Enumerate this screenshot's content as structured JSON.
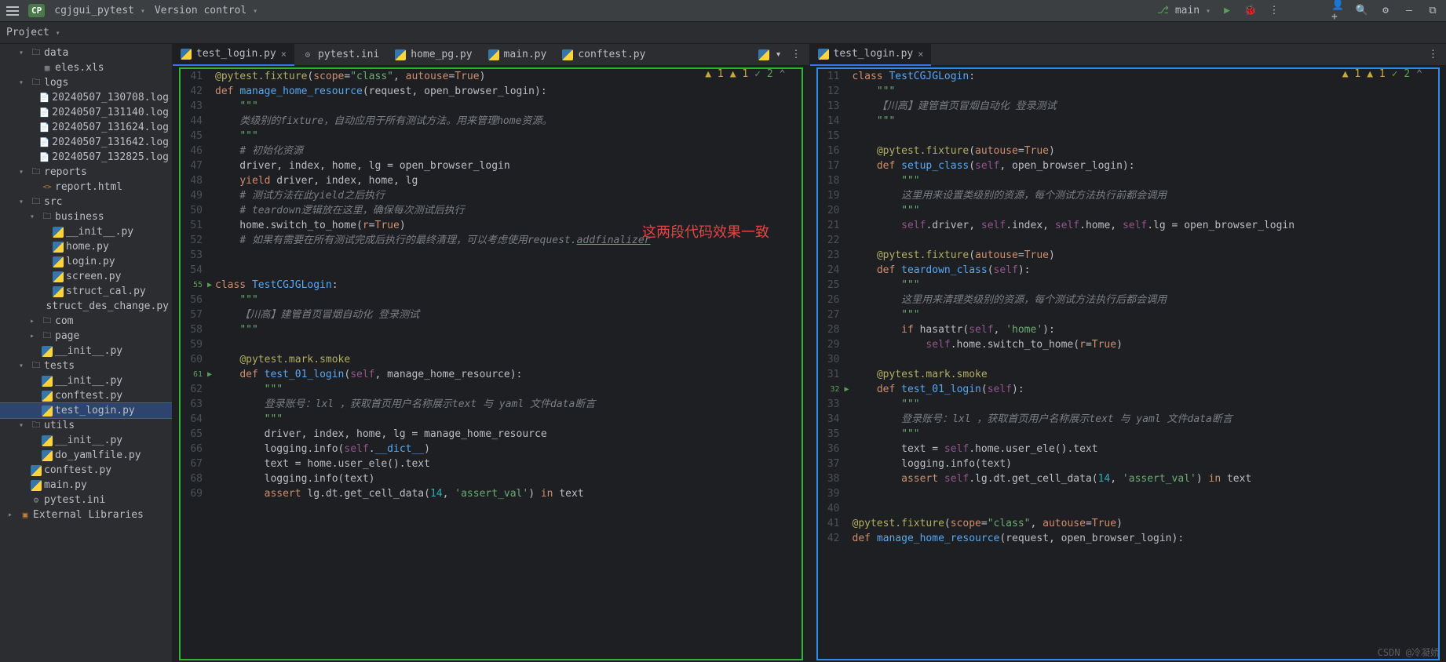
{
  "topbar": {
    "project_badge": "CP",
    "project_name": "cgjgui_pytest",
    "menu_vcs": "Version control",
    "branch": "main"
  },
  "project_header": {
    "title": "Project"
  },
  "tree": [
    {
      "indent": 1,
      "chev": "exp",
      "ico": "dir",
      "label": "data"
    },
    {
      "indent": 2,
      "chev": "none",
      "ico": "xls",
      "label": "eles.xls"
    },
    {
      "indent": 1,
      "chev": "exp",
      "ico": "dir",
      "label": "logs"
    },
    {
      "indent": 2,
      "chev": "none",
      "ico": "log",
      "label": "20240507_130708.log"
    },
    {
      "indent": 2,
      "chev": "none",
      "ico": "log",
      "label": "20240507_131140.log"
    },
    {
      "indent": 2,
      "chev": "none",
      "ico": "log",
      "label": "20240507_131624.log"
    },
    {
      "indent": 2,
      "chev": "none",
      "ico": "log",
      "label": "20240507_131642.log"
    },
    {
      "indent": 2,
      "chev": "none",
      "ico": "log",
      "label": "20240507_132825.log"
    },
    {
      "indent": 1,
      "chev": "exp",
      "ico": "dir",
      "label": "reports"
    },
    {
      "indent": 2,
      "chev": "none",
      "ico": "html",
      "label": "report.html"
    },
    {
      "indent": 1,
      "chev": "exp",
      "ico": "dir",
      "label": "src"
    },
    {
      "indent": 2,
      "chev": "exp",
      "ico": "dir",
      "label": "business"
    },
    {
      "indent": 3,
      "chev": "none",
      "ico": "py",
      "label": "__init__.py"
    },
    {
      "indent": 3,
      "chev": "none",
      "ico": "py",
      "label": "home.py"
    },
    {
      "indent": 3,
      "chev": "none",
      "ico": "py",
      "label": "login.py"
    },
    {
      "indent": 3,
      "chev": "none",
      "ico": "py",
      "label": "screen.py"
    },
    {
      "indent": 3,
      "chev": "none",
      "ico": "py",
      "label": "struct_cal.py"
    },
    {
      "indent": 3,
      "chev": "none",
      "ico": "py",
      "label": "struct_des_change.py"
    },
    {
      "indent": 2,
      "chev": "col",
      "ico": "dir",
      "label": "com"
    },
    {
      "indent": 2,
      "chev": "col",
      "ico": "dir",
      "label": "page"
    },
    {
      "indent": 2,
      "chev": "none",
      "ico": "py",
      "label": "__init__.py"
    },
    {
      "indent": 1,
      "chev": "exp",
      "ico": "dir",
      "label": "tests"
    },
    {
      "indent": 2,
      "chev": "none",
      "ico": "py",
      "label": "__init__.py"
    },
    {
      "indent": 2,
      "chev": "none",
      "ico": "py",
      "label": "conftest.py"
    },
    {
      "indent": 2,
      "chev": "none",
      "ico": "py",
      "label": "test_login.py",
      "selected": true
    },
    {
      "indent": 1,
      "chev": "exp",
      "ico": "dir",
      "label": "utils"
    },
    {
      "indent": 2,
      "chev": "none",
      "ico": "py",
      "label": "__init__.py"
    },
    {
      "indent": 2,
      "chev": "none",
      "ico": "py",
      "label": "do_yamlfile.py"
    },
    {
      "indent": 1,
      "chev": "none",
      "ico": "py",
      "label": "conftest.py"
    },
    {
      "indent": 1,
      "chev": "none",
      "ico": "py",
      "label": "main.py"
    },
    {
      "indent": 1,
      "chev": "none",
      "ico": "ini",
      "label": "pytest.ini"
    },
    {
      "indent": 0,
      "chev": "col",
      "ico": "libs",
      "label": "External Libraries"
    }
  ],
  "left_tabs": [
    {
      "name": "test_login.py",
      "active": true,
      "ico": "py"
    },
    {
      "name": "pytest.ini",
      "ico": "ini"
    },
    {
      "name": "home_pg.py",
      "ico": "py"
    },
    {
      "name": "main.py",
      "ico": "py"
    },
    {
      "name": "conftest.py",
      "ico": "py"
    }
  ],
  "right_tabs": [
    {
      "name": "test_login.py",
      "active": true,
      "ico": "py",
      "closable": true
    }
  ],
  "badges_left": {
    "warn1": "1",
    "warn2": "1",
    "check": "2"
  },
  "badges_right": {
    "warn1": "1",
    "warn2": "1",
    "check": "2"
  },
  "left_code": {
    "start": 41,
    "run_lines": [
      55,
      61
    ],
    "html": "<span class=dec>@pytest.fixture</span>(<span class=param>scope</span>=<span class=str>\"class\"</span>, <span class=param>autouse</span>=<span class=kw>True</span>)\n<span class=def>def</span> <span class=fn>manage_home_resource</span>(request, open_browser_login):\n    <span class=str>\"\"\"</span>\n    <span class=cmt>类级别的fixture，自动应用于所有测试方法。用来管理home资源。</span>\n    <span class=str>\"\"\"</span>\n    <span class=cmt># 初始化资源</span>\n    driver, index, home, lg = open_browser_login\n    <span class=kw>yield</span> driver, index, home, lg\n    <span class=cmt># 测试方法在此yield之后执行</span>\n    <span class=cmt># teardown逻辑放在这里，确保每次测试后执行</span>\n    home.switch_to_home(<span class=param>r</span>=<span class=kw>True</span>)\n    <span class=cmt># 如果有需要在所有测试完成后执行的最终清理，可以考虑使用request.<span class=underline>addfinalizer</span></span>\n\n\n<span class=def>class</span> <span class=fn>TestCGJGLogin</span>:\n    <span class=str>\"\"\"</span>\n    <span class=cmt>【川高】建管首页冒烟自动化 登录测试</span>\n    <span class=str>\"\"\"</span>\n\n    <span class=dec>@pytest.mark.smoke</span>\n    <span class=def>def</span> <span class=fn>test_01_login</span>(<span class=self>self</span>, manage_home_resource):\n        <span class=str>\"\"\"</span>\n        <span class=cmt>登录账号：lxl ，获取首页用户名称展示text 与 yaml 文件data断言</span>\n        <span class=str>\"\"\"</span>\n        driver, index, home, lg = manage_home_resource\n        logging.info(<span class=self>self</span>.<span class=fn>__dict__</span>)\n        text = home.user_ele().text\n        logging.info(text)\n        <span class=kw>assert</span> lg.dt.get_cell_data(<span class=num>14</span>, <span class=str>'assert_val'</span>) <span class=kw>in</span> text"
  },
  "right_code": {
    "start": 11,
    "run_lines": [
      32
    ],
    "html": "<span class=def>class</span> <span class=fn>TestCGJGLogin</span>:\n    <span class=str>\"\"\"</span>\n    <span class=cmt>【川高】建管首页冒烟自动化 登录测试</span>\n    <span class=str>\"\"\"</span>\n\n    <span class=dec>@pytest.fixture</span>(<span class=param>autouse</span>=<span class=kw>True</span>)\n    <span class=def>def</span> <span class=fn>setup_class</span>(<span class=self>self</span>, open_browser_login):\n        <span class=str>\"\"\"</span>\n        <span class=cmt>这里用来设置类级别的资源，每个测试方法执行前都会调用</span>\n        <span class=str>\"\"\"</span>\n        <span class=self>self</span>.driver, <span class=self>self</span>.index, <span class=self>self</span>.home, <span class=self>self</span>.lg = open_browser_login\n\n    <span class=dec>@pytest.fixture</span>(<span class=param>autouse</span>=<span class=kw>True</span>)\n    <span class=def>def</span> <span class=fn>teardown_class</span>(<span class=self>self</span>):\n        <span class=str>\"\"\"</span>\n        <span class=cmt>这里用来清理类级别的资源，每个测试方法执行后都会调用</span>\n        <span class=str>\"\"\"</span>\n        <span class=kw>if</span> hasattr(<span class=self>self</span>, <span class=str>'home'</span>):\n            <span class=self>self</span>.home.switch_to_home(<span class=param>r</span>=<span class=kw>True</span>)\n\n    <span class=dec>@pytest.mark.smoke</span>\n    <span class=def>def</span> <span class=fn>test_01_login</span>(<span class=self>self</span>):\n        <span class=str>\"\"\"</span>\n        <span class=cmt>登录账号：lxl ，获取首页用户名称展示text 与 yaml 文件data断言</span>\n        <span class=str>\"\"\"</span>\n        text = <span class=self>self</span>.home.user_ele().text\n        logging.info(text)\n        <span class=kw>assert</span> <span class=self>self</span>.lg.dt.get_cell_data(<span class=num>14</span>, <span class=str>'assert_val'</span>) <span class=kw>in</span> text\n\n\n<span class=dec>@pytest.fixture</span>(<span class=param>scope</span>=<span class=str>\"class\"</span>, <span class=param>autouse</span>=<span class=kw>True</span>)\n<span class=def>def</span> <span class=fn>manage_home_resource</span>(request, open_browser_login):"
  },
  "annotation": "这两段代码效果一致",
  "watermark": "CSDN @冷凝娇"
}
